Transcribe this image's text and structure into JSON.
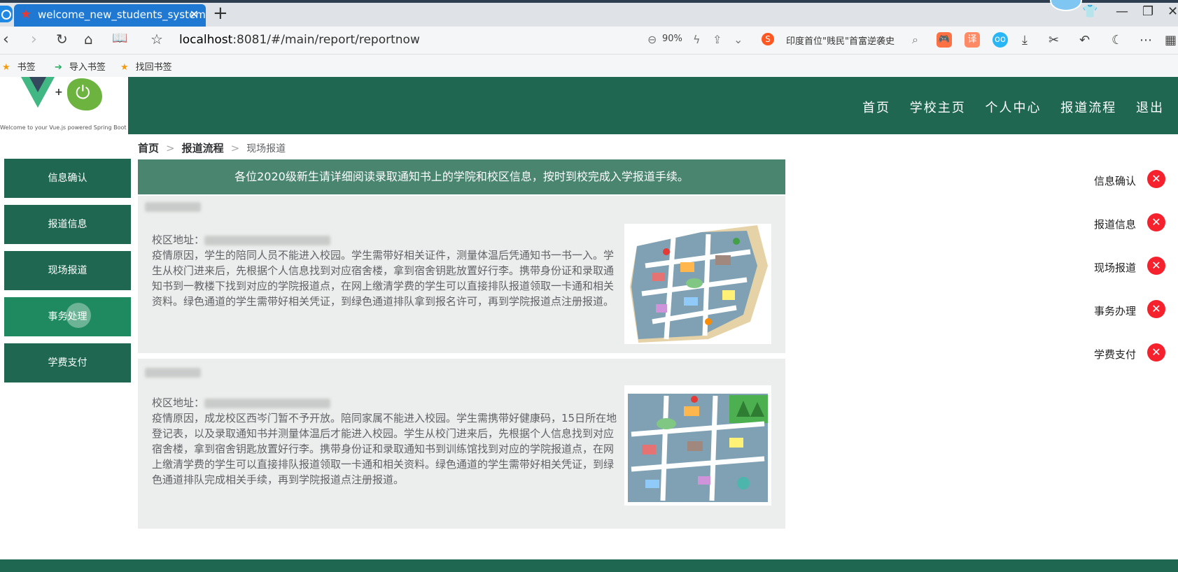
{
  "browser": {
    "tab_title": "welcome_new_students_system",
    "tab_close": "✕",
    "new_tab": "+",
    "url_host": "localhost",
    "url_rest": ":8081/#/main/report/reportnow",
    "zoom": "90%",
    "hot_search": "印度首位\"贱民\"首富逆袭史",
    "bookmarks": [
      {
        "label": "书签",
        "icon": "star-icon"
      },
      {
        "label": "导入书签",
        "icon": "import-icon"
      },
      {
        "label": "找回书签",
        "icon": "star-icon"
      }
    ]
  },
  "site": {
    "logo_caption": "Welcome to your Vue.js powered Spring Boot App",
    "nav": [
      "首页",
      "学校主页",
      "个人中心",
      "报道流程",
      "退出"
    ]
  },
  "breadcrumb": {
    "home": "首页",
    "section": "报道流程",
    "current": "现场报道"
  },
  "sidebar": {
    "items": [
      {
        "label": "信息确认"
      },
      {
        "label": "报道信息"
      },
      {
        "label": "现场报道"
      },
      {
        "label": "事务处理"
      },
      {
        "label": "学费支付"
      }
    ],
    "active_index": 3
  },
  "notice": "各位2020级新生请详细阅读录取通知书上的学院和校区信息，按时到校完成入学报道手续。",
  "campuses": [
    {
      "addr_label": "校区地址：",
      "desc": "疫情原因，学生的陪同人员不能进入校园。学生需带好相关证件，测量体温后凭通知书一书一入。学生从校门进来后，先根据个人信息找到对应宿舍楼，拿到宿舍钥匙放置好行李。携带身份证和录取通知书到一教楼下找到对应的学院报道点，在网上缴清学费的学生可以直接排队报道领取一卡通和相关资料。绿色通道的学生需带好相关凭证，到绿色通道排队拿到报名许可，再到学院报道点注册报道。"
    },
    {
      "addr_label": "校区地址：",
      "desc": "疫情原因，成龙校区西岑门暂不予开放。陪同家属不能进入校园。学生需携带好健康码，15日所在地登记表，以及录取通知书并测量体温后才能进入校园。学生从校门进来后，先根据个人信息找到对应宿舍楼，拿到宿舍钥匙放置好行李。携带身份证和录取通知书到训练馆找到对应的学院报道点，在网上缴清学费的学生可以直接排队报道领取一卡通和相关资料。绿色通道的学生需带好相关凭证，到绿色通道排队完成相关手续，再到学院报道点注册报道。"
    }
  ],
  "status": {
    "items": [
      {
        "label": "信息确认",
        "state": "incomplete"
      },
      {
        "label": "报道信息",
        "state": "incomplete"
      },
      {
        "label": "现场报道",
        "state": "incomplete"
      },
      {
        "label": "事务办理",
        "state": "incomplete"
      },
      {
        "label": "学费支付",
        "state": "incomplete"
      }
    ],
    "icon": "✕"
  },
  "colors": {
    "primary": "#206752",
    "active": "#1f8a5f",
    "notice": "#4a8570",
    "error": "#f5222d"
  }
}
